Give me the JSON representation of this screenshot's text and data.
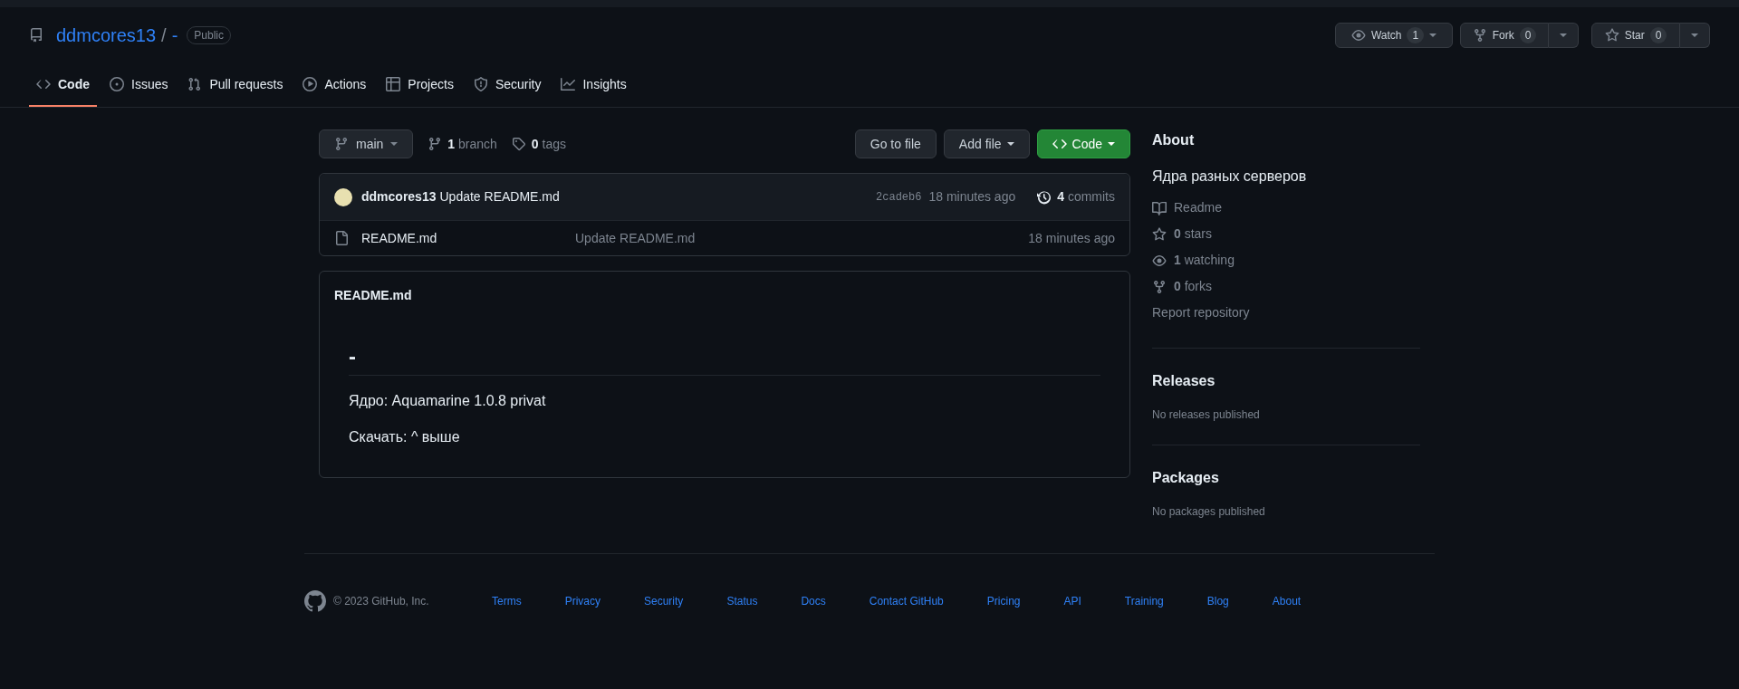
{
  "repo": {
    "owner": "ddmcores13",
    "separator": "/",
    "name": "-",
    "visibility": "Public"
  },
  "repo_actions": [
    {
      "kind": "watch",
      "label": "Watch",
      "count": "1"
    },
    {
      "kind": "fork",
      "label": "Fork",
      "count": "0"
    },
    {
      "kind": "star",
      "label": "Star",
      "count": "0"
    }
  ],
  "tabs": [
    {
      "kind": "code",
      "label": "Code",
      "selected": true
    },
    {
      "kind": "issues",
      "label": "Issues",
      "selected": false
    },
    {
      "kind": "pulls",
      "label": "Pull requests",
      "selected": false
    },
    {
      "kind": "actions",
      "label": "Actions",
      "selected": false
    },
    {
      "kind": "projects",
      "label": "Projects",
      "selected": false
    },
    {
      "kind": "security",
      "label": "Security",
      "selected": false
    },
    {
      "kind": "insights",
      "label": "Insights",
      "selected": false
    }
  ],
  "branch_bar": {
    "branch": "main",
    "branch_count": "1",
    "branch_label": "branch",
    "tag_count": "0",
    "tag_label": "tags",
    "buttons": [
      {
        "kind": "plain",
        "label": "Go to file"
      },
      {
        "kind": "dropdown",
        "label": "Add file"
      },
      {
        "kind": "primary",
        "label": "Code"
      }
    ]
  },
  "latest_commit": {
    "author": "ddmcores13",
    "message": "Update README.md",
    "sha": "2cadeb6",
    "time": "18 minutes ago",
    "commit_count": "4",
    "commit_label": "commits"
  },
  "files": [
    {
      "kind": "file",
      "name": "README.md",
      "message": "Update README.md",
      "time": "18 minutes ago"
    }
  ],
  "readme": {
    "title": "README.md",
    "heading": "-",
    "paragraphs": [
      "Ядро: Aquamarine 1.0.8 privat",
      "Скачать: ^ выше"
    ]
  },
  "about": {
    "title": "About",
    "description": "Ядра разных серверов",
    "links": [
      {
        "kind": "readme",
        "label": "Readme"
      },
      {
        "kind": "stars",
        "count": "0",
        "label": "stars"
      },
      {
        "kind": "watching",
        "count": "1",
        "label": "watching"
      },
      {
        "kind": "forks",
        "count": "0",
        "label": "forks"
      }
    ],
    "report": "Report repository"
  },
  "releases": {
    "title": "Releases",
    "text": "No releases published"
  },
  "packages": {
    "title": "Packages",
    "text": "No packages published"
  },
  "footer": {
    "copyright": "© 2023 GitHub, Inc.",
    "links": [
      "Terms",
      "Privacy",
      "Security",
      "Status",
      "Docs",
      "Contact GitHub",
      "Pricing",
      "API",
      "Training",
      "Blog",
      "About"
    ]
  }
}
